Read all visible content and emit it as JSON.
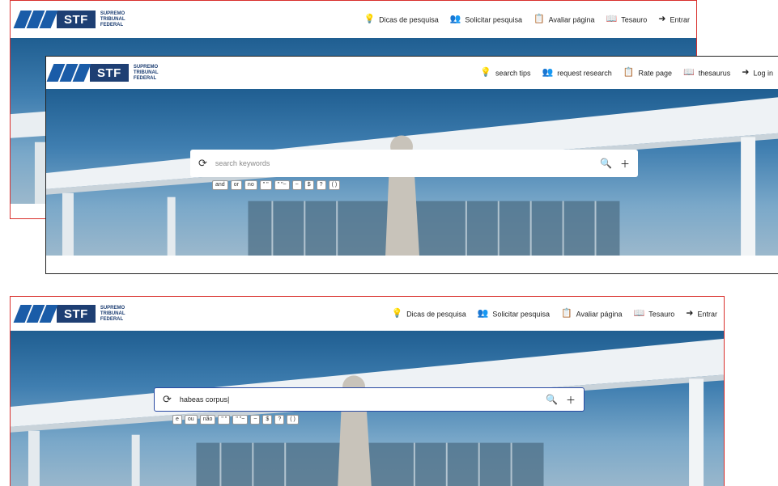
{
  "brand": {
    "abbr": "STF",
    "line1": "SUPREMO",
    "line2": "TRIBUNAL",
    "line3": "FEDERAL"
  },
  "panels": {
    "top": {
      "nav": [
        {
          "label": "Dicas de pesquisa",
          "icon": "lightbulb-icon"
        },
        {
          "label": "Solicitar pesquisa",
          "icon": "users-icon"
        },
        {
          "label": "Avaliar página",
          "icon": "clipboard-icon"
        },
        {
          "label": "Tesauro",
          "icon": "book-icon"
        },
        {
          "label": "Entrar",
          "icon": "login-icon"
        }
      ]
    },
    "middle": {
      "nav": [
        {
          "label": "search tips",
          "icon": "lightbulb-icon"
        },
        {
          "label": "request research",
          "icon": "users-icon"
        },
        {
          "label": "Rate page",
          "icon": "clipboard-icon"
        },
        {
          "label": "thesaurus",
          "icon": "book-icon"
        },
        {
          "label": "Log in",
          "icon": "login-icon"
        }
      ],
      "search": {
        "placeholder": "search keywords",
        "value": ""
      },
      "operators": [
        "and",
        "or",
        "no",
        "\" \"",
        "\" \"~",
        "~",
        "$",
        "?",
        "( )"
      ]
    },
    "bottom": {
      "nav": [
        {
          "label": "Dicas de pesquisa",
          "icon": "lightbulb-icon"
        },
        {
          "label": "Solicitar pesquisa",
          "icon": "users-icon"
        },
        {
          "label": "Avaliar página",
          "icon": "clipboard-icon"
        },
        {
          "label": "Tesauro",
          "icon": "book-icon"
        },
        {
          "label": "Entrar",
          "icon": "login-icon"
        }
      ],
      "search": {
        "placeholder": "",
        "value": "habeas corpus|"
      },
      "operators": [
        "e",
        "ou",
        "não",
        "\" \"",
        "\" \"~",
        "~",
        "$",
        "?",
        "( )"
      ]
    }
  },
  "colors": {
    "highlight_border": "#d9302c",
    "brand_blue": "#1e3f73",
    "search_focus": "#2a4aa3"
  }
}
